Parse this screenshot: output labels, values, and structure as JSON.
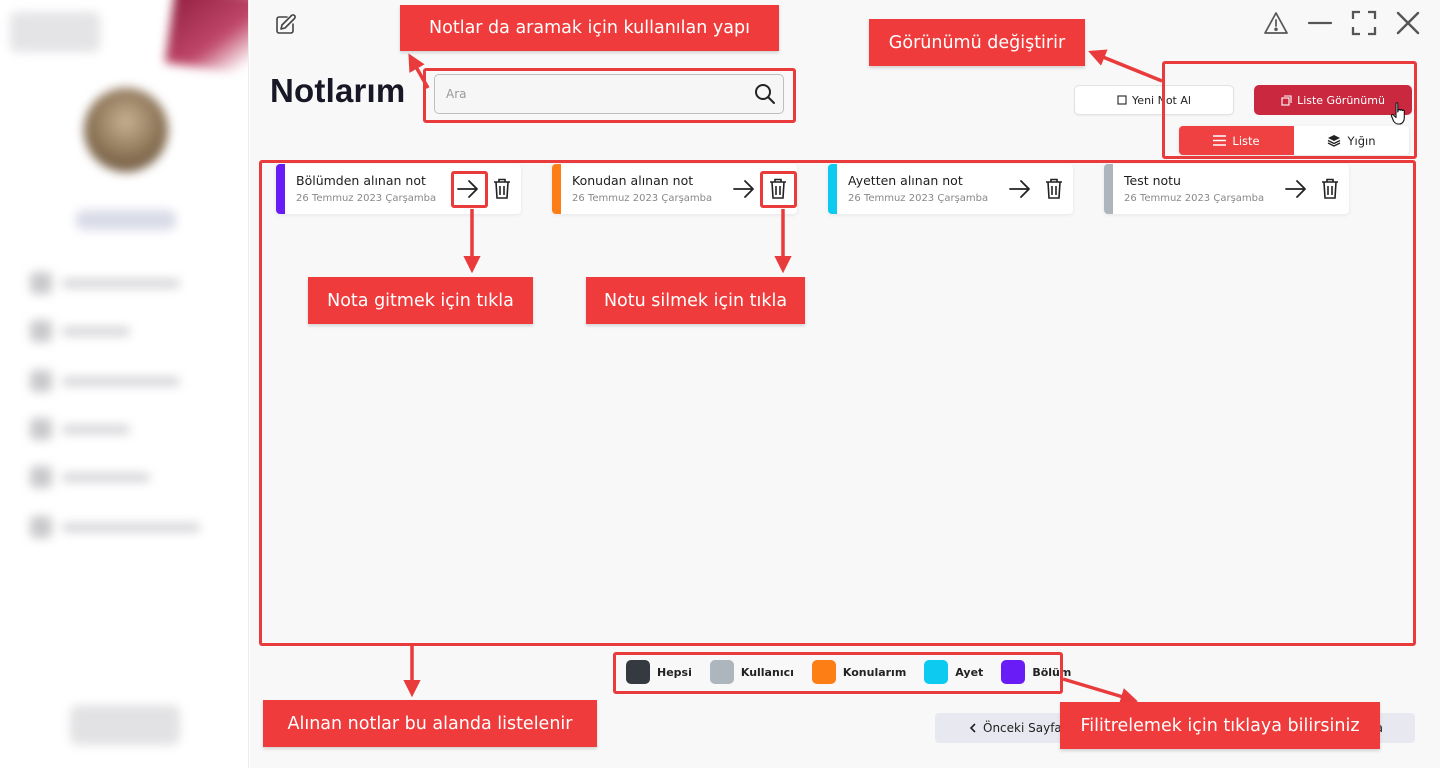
{
  "window": {
    "title": "Notlarım",
    "icons": [
      "edit-note-icon",
      "warning-icon",
      "minimize-icon",
      "fullscreen-icon",
      "close-icon"
    ]
  },
  "search": {
    "placeholder": "Ara",
    "value": ""
  },
  "toolbar": {
    "new_note_label": "Yeni Not Al",
    "view_button_label": "Liste Görünümü",
    "view_toggle": [
      {
        "label": "Liste",
        "active": true,
        "icon": "list-icon"
      },
      {
        "label": "Yığın",
        "active": false,
        "icon": "layers-icon"
      }
    ]
  },
  "notes": [
    {
      "title": "Bölümden alınan not",
      "date": "26 Temmuz 2023 Çarşamba",
      "color": "#6a1cf6"
    },
    {
      "title": "Konudan alınan not",
      "date": "26 Temmuz 2023 Çarşamba",
      "color": "#fd7e14"
    },
    {
      "title": "Ayetten alınan not",
      "date": "26 Temmuz 2023 Çarşamba",
      "color": "#0dcaf0"
    },
    {
      "title": "Test notu",
      "date": "26 Temmuz 2023 Çarşamba",
      "color": "#adb5bd"
    }
  ],
  "filters": [
    {
      "label": "Hepsi",
      "color": "#343a40"
    },
    {
      "label": "Kullanıcı",
      "color": "#adb5bd"
    },
    {
      "label": "Konularım",
      "color": "#fd7e14"
    },
    {
      "label": "Ayet",
      "color": "#0dcaf0"
    },
    {
      "label": "Bölüm",
      "color": "#6a1cf6"
    }
  ],
  "pagination": {
    "prev_label": "Önceki Sayfa",
    "next_label": "a"
  },
  "annotations": {
    "search": "Notlar da aramak için kullanılan yapı",
    "view": "Görünümü değiştirir",
    "go": "Nota gitmek için tıkla",
    "delete": "Notu silmek için tıkla",
    "list_area": "Alınan notlar bu alanda listelenir",
    "filter": "Filitrelemek için tıklaya bilirsiniz"
  },
  "colors": {
    "accent": "#c9283f",
    "toggle_active": "#ef4141",
    "annotation": "#ef3b3b"
  }
}
